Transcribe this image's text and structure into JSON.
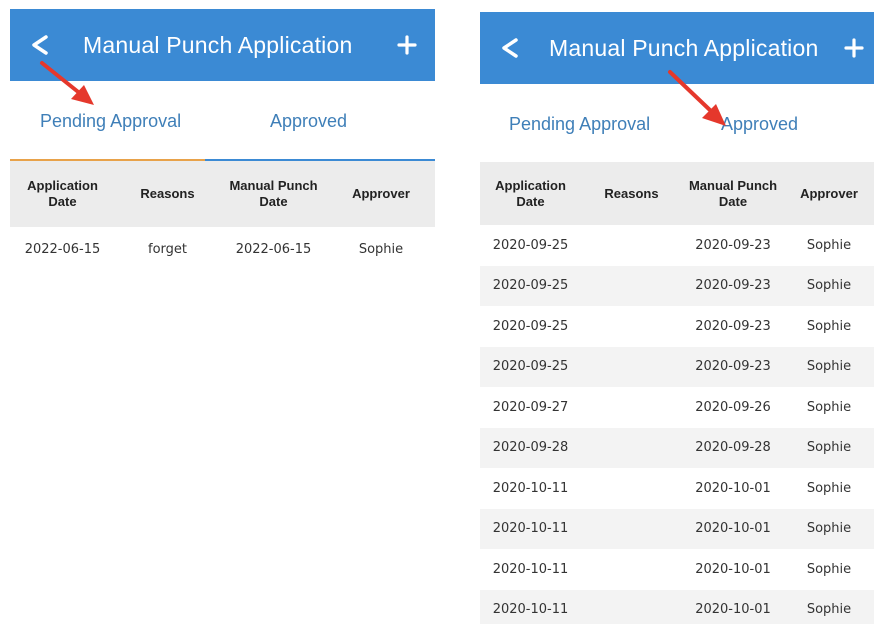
{
  "colors": {
    "header_bg": "#3b8ad4",
    "tab_text": "#3f7fb8",
    "underline_blue": "#3b8ad4",
    "underline_orange": "#e8a24a",
    "arrow_red": "#e5382c"
  },
  "left": {
    "header": {
      "back": "<",
      "title": "Manual Punch Application",
      "add": "+"
    },
    "tabs": [
      "Pending Approval",
      "Approved"
    ],
    "columns": [
      "Application Date",
      "Reasons",
      "Manual Punch Date",
      "Approver"
    ],
    "rows": [
      [
        "2022-06-15",
        "forget",
        "2022-06-15",
        "Sophie"
      ]
    ]
  },
  "right": {
    "header": {
      "back": "<",
      "title": "Manual Punch Application",
      "add": "+"
    },
    "tabs": [
      "Pending Approval",
      "Approved"
    ],
    "columns": [
      "Application Date",
      "Reasons",
      "Manual Punch Date",
      "Approver"
    ],
    "rows": [
      [
        "2020-09-25",
        "",
        "2020-09-23",
        "Sophie"
      ],
      [
        "2020-09-25",
        "",
        "2020-09-23",
        "Sophie"
      ],
      [
        "2020-09-25",
        "",
        "2020-09-23",
        "Sophie"
      ],
      [
        "2020-09-25",
        "",
        "2020-09-23",
        "Sophie"
      ],
      [
        "2020-09-27",
        "",
        "2020-09-26",
        "Sophie"
      ],
      [
        "2020-09-28",
        "",
        "2020-09-28",
        "Sophie"
      ],
      [
        "2020-10-11",
        "",
        "2020-10-01",
        "Sophie"
      ],
      [
        "2020-10-11",
        "",
        "2020-10-01",
        "Sophie"
      ],
      [
        "2020-10-11",
        "",
        "2020-10-01",
        "Sophie"
      ],
      [
        "2020-10-11",
        "",
        "2020-10-01",
        "Sophie"
      ]
    ]
  }
}
